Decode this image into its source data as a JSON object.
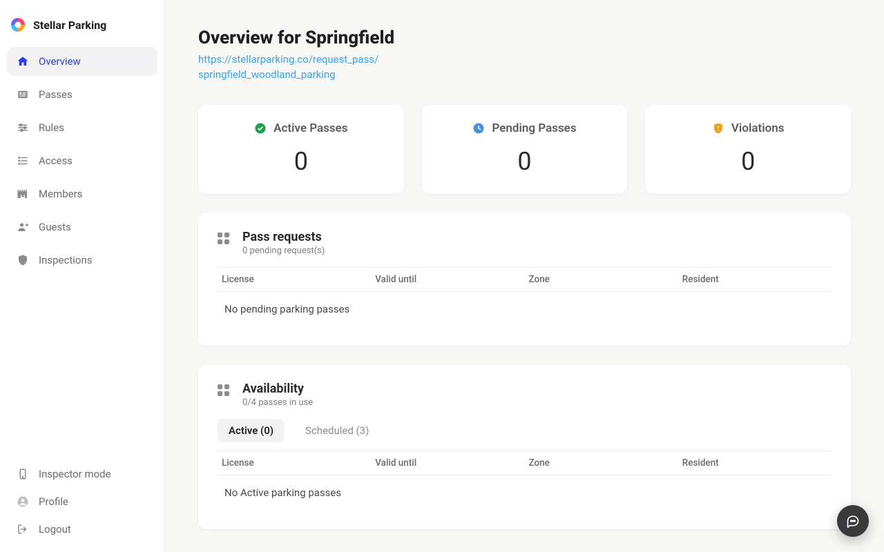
{
  "brand": {
    "name": "Stellar Parking"
  },
  "sidebar": {
    "nav": [
      {
        "label": "Overview",
        "key": "overview"
      },
      {
        "label": "Passes",
        "key": "passes"
      },
      {
        "label": "Rules",
        "key": "rules"
      },
      {
        "label": "Access",
        "key": "access"
      },
      {
        "label": "Members",
        "key": "members"
      },
      {
        "label": "Guests",
        "key": "guests"
      },
      {
        "label": "Inspections",
        "key": "inspections"
      }
    ],
    "footer": [
      {
        "label": "Inspector mode",
        "key": "inspector-mode"
      },
      {
        "label": "Profile",
        "key": "profile"
      },
      {
        "label": "Logout",
        "key": "logout"
      }
    ]
  },
  "header": {
    "title": "Overview for Springfield",
    "link_line1": "https://stellarparking.co/request_pass/",
    "link_line2": "springfield_woodland_parking"
  },
  "stats": {
    "active": {
      "label": "Active Passes",
      "value": "0",
      "color": "#16a34a"
    },
    "pending": {
      "label": "Pending Passes",
      "value": "0",
      "color": "#4a90e2"
    },
    "viol": {
      "label": "Violations",
      "value": "0",
      "color": "#f59e0b"
    }
  },
  "pass_requests": {
    "title": "Pass requests",
    "subtitle": "0 pending request(s)",
    "columns": [
      "License",
      "Valid until",
      "Zone",
      "Resident"
    ],
    "empty": "No pending parking passes"
  },
  "availability": {
    "title": "Availability",
    "subtitle": "0/4 passes in use",
    "tabs": {
      "active": {
        "label": "Active (0)"
      },
      "scheduled": {
        "label": "Scheduled (3)"
      }
    },
    "columns": [
      "License",
      "Valid until",
      "Zone",
      "Resident"
    ],
    "empty": "No Active parking passes"
  }
}
